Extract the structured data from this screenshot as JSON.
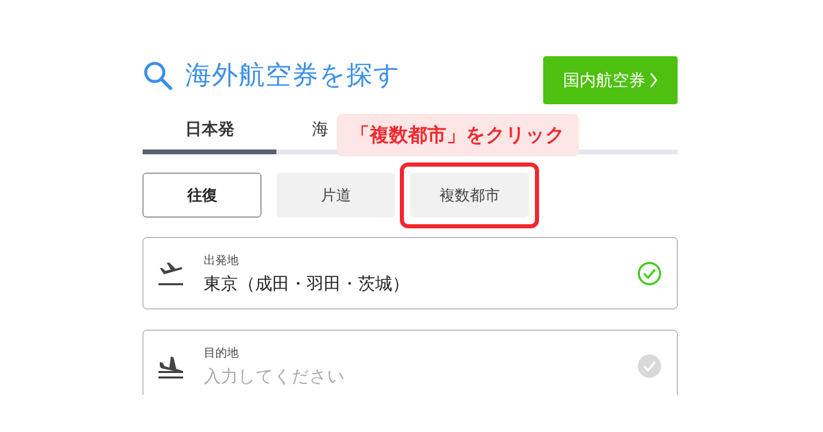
{
  "header": {
    "title": "海外航空券を探す",
    "domestic_button": "国内航空券"
  },
  "tabs": [
    {
      "label": "日本発",
      "selected": true
    },
    {
      "label": "海",
      "selected": false
    }
  ],
  "trip_types": [
    {
      "label": "往復",
      "selected": true
    },
    {
      "label": "片道",
      "selected": false
    },
    {
      "label": "複数都市",
      "selected": false,
      "highlighted": true
    }
  ],
  "fields": [
    {
      "kind": "departure",
      "label": "出発地",
      "value": "東京（成田・羽田・茨城）",
      "valid": true
    },
    {
      "kind": "arrival",
      "label": "目的地",
      "placeholder": "入力してください",
      "valid": false
    }
  ],
  "callout": {
    "text": "「複数都市」をクリック"
  }
}
